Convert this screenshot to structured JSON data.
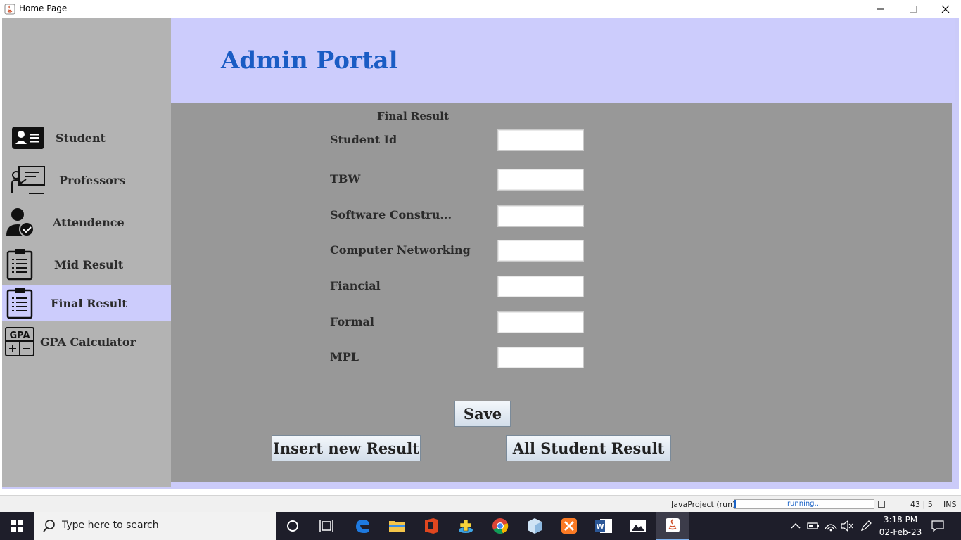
{
  "window": {
    "title": "Home Page"
  },
  "header": {
    "title": "Admin Portal"
  },
  "sidebar": {
    "items": [
      {
        "label": "Student",
        "icon": "student-id-card-icon"
      },
      {
        "label": "Professors",
        "icon": "professor-board-icon"
      },
      {
        "label": "Attendence",
        "icon": "attendance-check-icon"
      },
      {
        "label": "Mid Result",
        "icon": "clipboard-list-icon"
      },
      {
        "label": "Final Result",
        "icon": "clipboard-list-icon",
        "active": true
      },
      {
        "label": "GPA Calculator",
        "icon": "gpa-calculator-icon"
      }
    ]
  },
  "form": {
    "title": "Final Result",
    "fields": [
      {
        "label": "Student Id",
        "value": ""
      },
      {
        "label": "TBW",
        "value": ""
      },
      {
        "label": "Software Constru...",
        "value": ""
      },
      {
        "label": "Computer Networking",
        "value": ""
      },
      {
        "label": "Fiancial",
        "value": ""
      },
      {
        "label": "Formal",
        "value": ""
      },
      {
        "label": "MPL",
        "value": ""
      }
    ],
    "save_label": "Save",
    "insert_label": "Insert new Result",
    "all_label": "All Student Result"
  },
  "statusbar": {
    "project": "JavaProject (run)",
    "progress_text": "running...",
    "position": "43 | 5",
    "mode": "INS"
  },
  "taskbar": {
    "search_placeholder": "Type here to search",
    "time": "3:18 PM",
    "date": "02-Feb-23"
  },
  "colors": {
    "accent": "#1a5cc4",
    "sidebar": "#b3b3b3",
    "content": "#989898",
    "header": "#ccccfc"
  }
}
